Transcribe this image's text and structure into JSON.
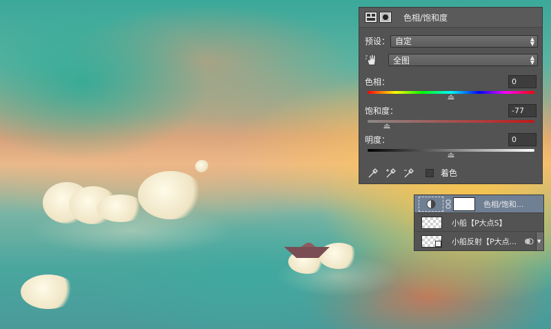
{
  "panel": {
    "title": "色相/饱和度",
    "preset_label": "预设：",
    "preset_value": "自定",
    "range_value": "全图",
    "hue_label": "色相：",
    "hue_value": "0",
    "saturation_label": "饱和度：",
    "saturation_value": "-77",
    "lightness_label": "明度：",
    "lightness_value": "0",
    "colorize_label": "着色",
    "colorize_checked": false,
    "hue_level": 0.5,
    "saturation_level": 0.115,
    "lightness_level": 0.5
  },
  "layers": [
    {
      "name": "色相/饱和...",
      "type": "adjustment",
      "selected": true
    },
    {
      "name": "小船【P大点S】",
      "type": "pixel",
      "selected": false
    },
    {
      "name": "小船反射【P大点...",
      "type": "smart-object",
      "selected": false
    }
  ],
  "icons": {
    "adjustment": "hue-saturation-icon",
    "mask": "layer-mask-icon",
    "targeted": "hand-adjust-icon",
    "droppers": [
      "eyedropper-icon",
      "eyedropper-plus-icon",
      "eyedropper-minus-icon"
    ],
    "link": "chain-link-icon",
    "layer_visibility": "eye-icon"
  },
  "colors": {
    "panel_bg": "#535353",
    "selected_layer": "#6f7f94"
  }
}
